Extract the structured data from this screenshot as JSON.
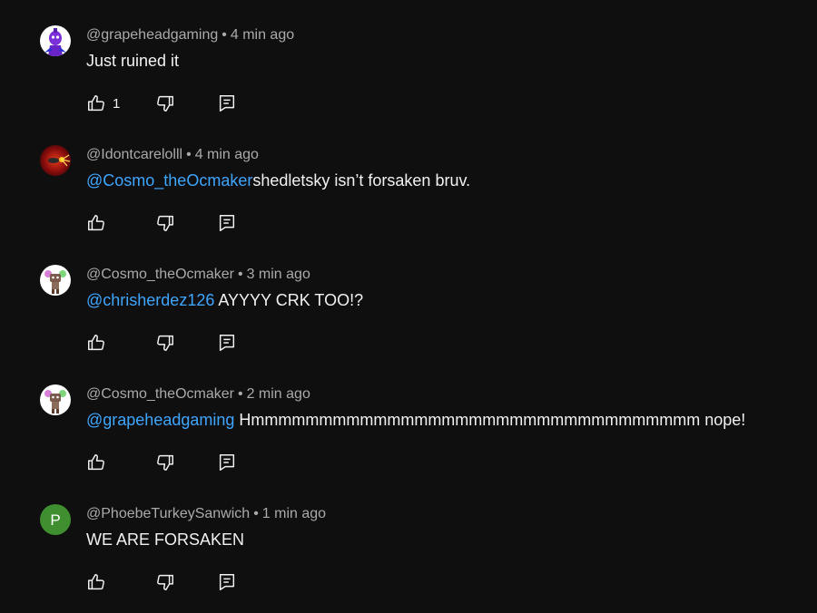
{
  "colors": {
    "background": "#0f0f0f",
    "text": "#f1f1f1",
    "meta": "#aaaaaa",
    "mention": "#3ea6ff"
  },
  "comments": [
    {
      "author": "@grapeheadgaming",
      "separator": "•",
      "time": "4 min ago",
      "mention": "",
      "body": "Just ruined it",
      "likes": "1",
      "avatar_icon": "purple-character-avatar"
    },
    {
      "author": "@Idontcarelolll",
      "separator": "•",
      "time": "4 min ago",
      "mention": "@Cosmo_theOcmaker",
      "body": "shedletsky isn’t forsaken bruv.",
      "likes": "",
      "avatar_icon": "red-burst-avatar"
    },
    {
      "author": "@Cosmo_theOcmaker",
      "separator": "•",
      "time": "3 min ago",
      "mention": "@chrisherdez126",
      "body": " AYYYY CRK TOO!?",
      "likes": "",
      "avatar_icon": "cartoon-character-avatar"
    },
    {
      "author": "@Cosmo_theOcmaker",
      "separator": "•",
      "time": "2 min ago",
      "mention": "@grapeheadgaming",
      "body": " Hmmmmmmmmmmmmmmmmmmmmmmmmmmmmmmmmm nope!",
      "likes": "",
      "avatar_icon": "cartoon-character-avatar"
    },
    {
      "author": "@PhoebeTurkeySanwich",
      "separator": "•",
      "time": "1 min ago",
      "mention": "",
      "body": "WE ARE FORSAKEN",
      "likes": "",
      "avatar_icon": "letter-avatar",
      "avatar_letter": "P"
    }
  ]
}
